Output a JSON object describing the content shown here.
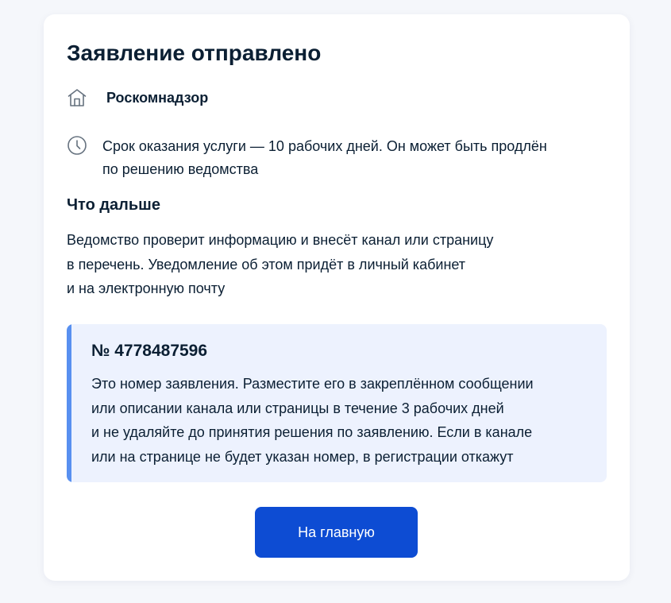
{
  "title": "Заявление отправлено",
  "agency": {
    "icon": "building-icon",
    "name": "Роскомнадзор"
  },
  "term": {
    "icon": "clock-icon",
    "lines": [
      "Срок оказания услуги — 10 рабочих дней. Он может быть продлён",
      "по решению ведомства"
    ]
  },
  "next": {
    "heading": "Что дальше",
    "lines": [
      "Ведомство проверит информацию и внесёт канал или страницу",
      "в перечень. Уведомление об этом придёт в личный кабинет",
      "и на электронную почту"
    ]
  },
  "notice": {
    "number": "№ 4778487596",
    "lines": [
      "Это номер заявления. Разместите его в закреплённом сообщении",
      "или описании канала или страницы в течение 3 рабочих дней",
      "и не удаляйте до принятия решения по заявлению. Если в канале",
      "или на странице не будет указан номер, в регистрации откажут"
    ]
  },
  "button": {
    "home_label": "На главную"
  },
  "colors": {
    "accent": "#0d4cd3",
    "notice_bg": "#edf2fe",
    "notice_bar": "#5890f0",
    "text": "#0b1f33",
    "page_bg": "#f5f7fb"
  }
}
